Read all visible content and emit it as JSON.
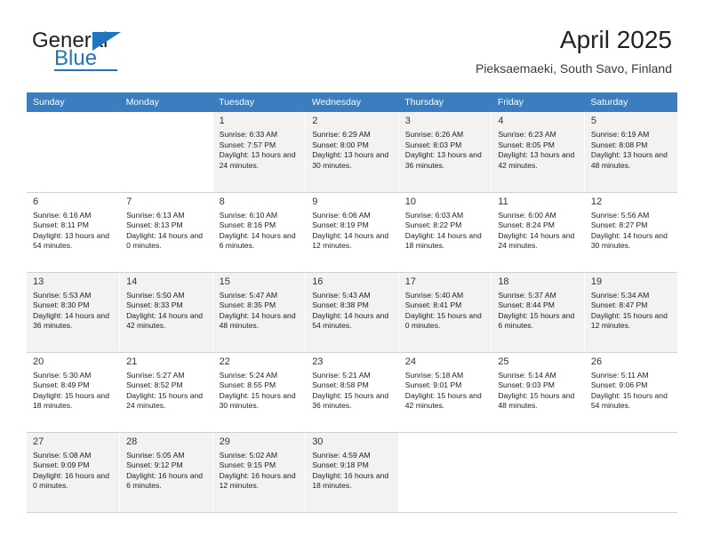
{
  "brand": {
    "name_part1": "General",
    "name_part2": "Blue",
    "accent_color": "#1f76bc",
    "triangle_icon": "triangle-icon"
  },
  "header": {
    "title": "April 2025",
    "location": "Pieksaemaeki, South Savo, Finland"
  },
  "calendar": {
    "header_bg": "#3b7dbf",
    "weekday_headers": [
      "Sunday",
      "Monday",
      "Tuesday",
      "Wednesday",
      "Thursday",
      "Friday",
      "Saturday"
    ],
    "weeks": [
      [
        {
          "day": "",
          "sunrise": "",
          "sunset": "",
          "daylight": ""
        },
        {
          "day": "",
          "sunrise": "",
          "sunset": "",
          "daylight": ""
        },
        {
          "day": "1",
          "sunrise": "Sunrise: 6:33 AM",
          "sunset": "Sunset: 7:57 PM",
          "daylight": "Daylight: 13 hours and 24 minutes."
        },
        {
          "day": "2",
          "sunrise": "Sunrise: 6:29 AM",
          "sunset": "Sunset: 8:00 PM",
          "daylight": "Daylight: 13 hours and 30 minutes."
        },
        {
          "day": "3",
          "sunrise": "Sunrise: 6:26 AM",
          "sunset": "Sunset: 8:03 PM",
          "daylight": "Daylight: 13 hours and 36 minutes."
        },
        {
          "day": "4",
          "sunrise": "Sunrise: 6:23 AM",
          "sunset": "Sunset: 8:05 PM",
          "daylight": "Daylight: 13 hours and 42 minutes."
        },
        {
          "day": "5",
          "sunrise": "Sunrise: 6:19 AM",
          "sunset": "Sunset: 8:08 PM",
          "daylight": "Daylight: 13 hours and 48 minutes."
        }
      ],
      [
        {
          "day": "6",
          "sunrise": "Sunrise: 6:16 AM",
          "sunset": "Sunset: 8:11 PM",
          "daylight": "Daylight: 13 hours and 54 minutes."
        },
        {
          "day": "7",
          "sunrise": "Sunrise: 6:13 AM",
          "sunset": "Sunset: 8:13 PM",
          "daylight": "Daylight: 14 hours and 0 minutes."
        },
        {
          "day": "8",
          "sunrise": "Sunrise: 6:10 AM",
          "sunset": "Sunset: 8:16 PM",
          "daylight": "Daylight: 14 hours and 6 minutes."
        },
        {
          "day": "9",
          "sunrise": "Sunrise: 6:06 AM",
          "sunset": "Sunset: 8:19 PM",
          "daylight": "Daylight: 14 hours and 12 minutes."
        },
        {
          "day": "10",
          "sunrise": "Sunrise: 6:03 AM",
          "sunset": "Sunset: 8:22 PM",
          "daylight": "Daylight: 14 hours and 18 minutes."
        },
        {
          "day": "11",
          "sunrise": "Sunrise: 6:00 AM",
          "sunset": "Sunset: 8:24 PM",
          "daylight": "Daylight: 14 hours and 24 minutes."
        },
        {
          "day": "12",
          "sunrise": "Sunrise: 5:56 AM",
          "sunset": "Sunset: 8:27 PM",
          "daylight": "Daylight: 14 hours and 30 minutes."
        }
      ],
      [
        {
          "day": "13",
          "sunrise": "Sunrise: 5:53 AM",
          "sunset": "Sunset: 8:30 PM",
          "daylight": "Daylight: 14 hours and 36 minutes."
        },
        {
          "day": "14",
          "sunrise": "Sunrise: 5:50 AM",
          "sunset": "Sunset: 8:33 PM",
          "daylight": "Daylight: 14 hours and 42 minutes."
        },
        {
          "day": "15",
          "sunrise": "Sunrise: 5:47 AM",
          "sunset": "Sunset: 8:35 PM",
          "daylight": "Daylight: 14 hours and 48 minutes."
        },
        {
          "day": "16",
          "sunrise": "Sunrise: 5:43 AM",
          "sunset": "Sunset: 8:38 PM",
          "daylight": "Daylight: 14 hours and 54 minutes."
        },
        {
          "day": "17",
          "sunrise": "Sunrise: 5:40 AM",
          "sunset": "Sunset: 8:41 PM",
          "daylight": "Daylight: 15 hours and 0 minutes."
        },
        {
          "day": "18",
          "sunrise": "Sunrise: 5:37 AM",
          "sunset": "Sunset: 8:44 PM",
          "daylight": "Daylight: 15 hours and 6 minutes."
        },
        {
          "day": "19",
          "sunrise": "Sunrise: 5:34 AM",
          "sunset": "Sunset: 8:47 PM",
          "daylight": "Daylight: 15 hours and 12 minutes."
        }
      ],
      [
        {
          "day": "20",
          "sunrise": "Sunrise: 5:30 AM",
          "sunset": "Sunset: 8:49 PM",
          "daylight": "Daylight: 15 hours and 18 minutes."
        },
        {
          "day": "21",
          "sunrise": "Sunrise: 5:27 AM",
          "sunset": "Sunset: 8:52 PM",
          "daylight": "Daylight: 15 hours and 24 minutes."
        },
        {
          "day": "22",
          "sunrise": "Sunrise: 5:24 AM",
          "sunset": "Sunset: 8:55 PM",
          "daylight": "Daylight: 15 hours and 30 minutes."
        },
        {
          "day": "23",
          "sunrise": "Sunrise: 5:21 AM",
          "sunset": "Sunset: 8:58 PM",
          "daylight": "Daylight: 15 hours and 36 minutes."
        },
        {
          "day": "24",
          "sunrise": "Sunrise: 5:18 AM",
          "sunset": "Sunset: 9:01 PM",
          "daylight": "Daylight: 15 hours and 42 minutes."
        },
        {
          "day": "25",
          "sunrise": "Sunrise: 5:14 AM",
          "sunset": "Sunset: 9:03 PM",
          "daylight": "Daylight: 15 hours and 48 minutes."
        },
        {
          "day": "26",
          "sunrise": "Sunrise: 5:11 AM",
          "sunset": "Sunset: 9:06 PM",
          "daylight": "Daylight: 15 hours and 54 minutes."
        }
      ],
      [
        {
          "day": "27",
          "sunrise": "Sunrise: 5:08 AM",
          "sunset": "Sunset: 9:09 PM",
          "daylight": "Daylight: 16 hours and 0 minutes."
        },
        {
          "day": "28",
          "sunrise": "Sunrise: 5:05 AM",
          "sunset": "Sunset: 9:12 PM",
          "daylight": "Daylight: 16 hours and 6 minutes."
        },
        {
          "day": "29",
          "sunrise": "Sunrise: 5:02 AM",
          "sunset": "Sunset: 9:15 PM",
          "daylight": "Daylight: 16 hours and 12 minutes."
        },
        {
          "day": "30",
          "sunrise": "Sunrise: 4:59 AM",
          "sunset": "Sunset: 9:18 PM",
          "daylight": "Daylight: 16 hours and 18 minutes."
        },
        {
          "day": "",
          "sunrise": "",
          "sunset": "",
          "daylight": ""
        },
        {
          "day": "",
          "sunrise": "",
          "sunset": "",
          "daylight": ""
        },
        {
          "day": "",
          "sunrise": "",
          "sunset": "",
          "daylight": ""
        }
      ]
    ]
  }
}
